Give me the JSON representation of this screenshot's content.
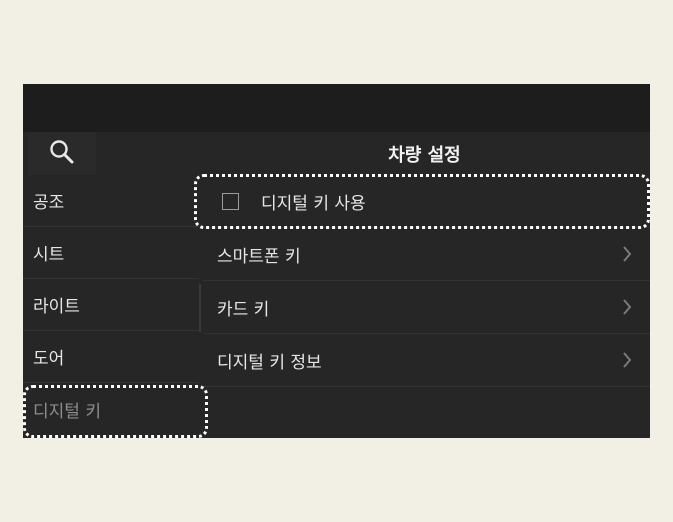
{
  "header": {
    "title": "차량 설정"
  },
  "search": {
    "icon": "search-icon"
  },
  "sidebar": {
    "items": [
      {
        "label": "공조"
      },
      {
        "label": "시트"
      },
      {
        "label": "라이트"
      },
      {
        "label": "도어"
      },
      {
        "label": "디지털 키",
        "active": true
      }
    ]
  },
  "settings": {
    "use_digital_key": {
      "label": "디지털 키 사용",
      "checked": false
    },
    "rows": [
      {
        "label": "스마트폰 키",
        "icon": "chevron-right-icon"
      },
      {
        "label": "카드 키",
        "icon": "chevron-right-icon"
      },
      {
        "label": "디지털 키 정보",
        "icon": "chevron-right-icon"
      }
    ]
  },
  "colors": {
    "background": "#f2efe4",
    "screen": "#262626",
    "highlight": "#ffffff"
  }
}
